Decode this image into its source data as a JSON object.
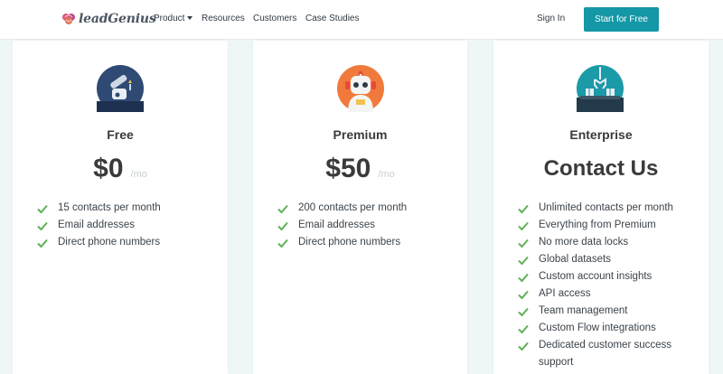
{
  "brand": {
    "logo_text": "leadGenius"
  },
  "nav": {
    "product": "Product",
    "resources": "Resources",
    "customers": "Customers",
    "case_studies": "Case Studies",
    "sign_in": "Sign In",
    "cta": "Start for Free"
  },
  "colors": {
    "accent": "#1497a6",
    "check": "#5fb157"
  },
  "plans": [
    {
      "name": "Free",
      "icon": "telescope-icon",
      "price": "$0",
      "per": "/mo",
      "features": [
        "15 contacts per month",
        "Email addresses",
        "Direct phone numbers"
      ]
    },
    {
      "name": "Premium",
      "icon": "robot-icon",
      "price": "$50",
      "per": "/mo",
      "features": [
        "200 contacts per month",
        "Email addresses",
        "Direct phone numbers"
      ]
    },
    {
      "name": "Enterprise",
      "icon": "robot-arm-icon",
      "contact": "Contact Us",
      "features": [
        "Unlimited contacts per month",
        "Everything from Premium",
        "No more data locks",
        "Global datasets",
        "Custom account insights",
        "API access",
        "Team management",
        "Custom Flow integrations",
        "Dedicated customer success support"
      ]
    }
  ]
}
